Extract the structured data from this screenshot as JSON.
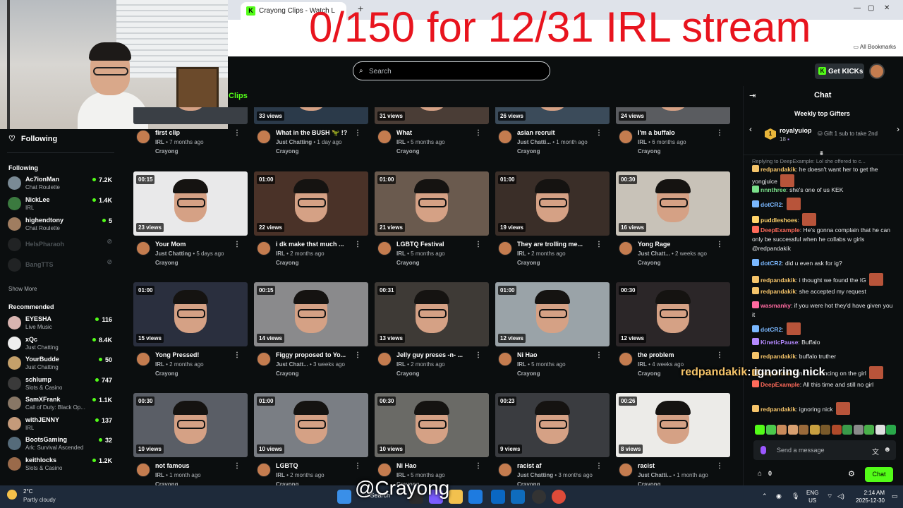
{
  "browser": {
    "tab_title": "Crayong Clips - Watch L",
    "new_tab": "+",
    "bookmarks_label": "All Bookmarks"
  },
  "overlay": {
    "goal_text": "0/150 for 12/31 IRL stream",
    "chat_user": "redpandakik",
    "chat_text": ": ignoring nick",
    "watermark": "@Crayong"
  },
  "topnav": {
    "search_placeholder": "Search",
    "get_kicks": "Get KICKs"
  },
  "sidebar": {
    "following_button": "Following",
    "following_header": "Following",
    "following": [
      {
        "name": "Ac7ionMan",
        "category": "Chat Roulette",
        "viewers": "7.2K",
        "online": true,
        "color": "#7a8a95"
      },
      {
        "name": "NickLee",
        "category": "IRL",
        "viewers": "1.4K",
        "online": true,
        "color": "#3b7a3f"
      },
      {
        "name": "highendtony",
        "category": "Chat Roulette",
        "viewers": "5",
        "online": true,
        "color": "#a07d60"
      },
      {
        "name": "HelsPharaoh",
        "category": "",
        "viewers": "",
        "online": false,
        "color": "#555"
      },
      {
        "name": "BangTTS",
        "category": "",
        "viewers": "",
        "online": false,
        "color": "#555"
      }
    ],
    "show_more": "Show More",
    "recommended_header": "Recommended",
    "recommended": [
      {
        "name": "EYESHA",
        "category": "Live Music",
        "viewers": "116",
        "color": "#d8b4b0"
      },
      {
        "name": "xQc",
        "category": "Just Chatting",
        "viewers": "8.4K",
        "color": "#eeeeee"
      },
      {
        "name": "YourBudde",
        "category": "Just Chatting",
        "viewers": "50",
        "color": "#c4a06a"
      },
      {
        "name": "schlump",
        "category": "Slots & Casino",
        "viewers": "747",
        "color": "#3a3a3a"
      },
      {
        "name": "SamXFrank",
        "category": "Call of Duty: Black Op...",
        "viewers": "1.1K",
        "color": "#887766"
      },
      {
        "name": "withJENNY",
        "category": "IRL",
        "viewers": "137",
        "color": "#c49a7a"
      },
      {
        "name": "BootsGaming",
        "category": "Ark: Survival Ascended",
        "viewers": "32",
        "color": "#556b7a"
      },
      {
        "name": "keithlocks",
        "category": "Slots & Casino",
        "viewers": "1.2K",
        "color": "#9a6a4a"
      }
    ]
  },
  "clips": {
    "section_label": "Clips",
    "items": [
      {
        "title": "first clip",
        "category": "IRL",
        "age": "7 months ago",
        "channel": "Crayong",
        "duration": "",
        "views": "",
        "bg": "#3a3f45"
      },
      {
        "title": "What in the BUSH 🦖 !?",
        "category": "Just Chatting",
        "age": "1 day ago",
        "channel": "Crayong",
        "duration": "",
        "views": "33 views",
        "bg": "#2b3a4a"
      },
      {
        "title": "What",
        "category": "IRL",
        "age": "5 months ago",
        "channel": "Crayong",
        "duration": "",
        "views": "31 views",
        "bg": "#4a3d36"
      },
      {
        "title": "asian recruit",
        "category": "Just Chatti...",
        "age": "1 month ago",
        "channel": "Crayong",
        "duration": "",
        "views": "26 views",
        "bg": "#3b4b5a"
      },
      {
        "title": "I'm a buffalo",
        "category": "IRL",
        "age": "6 months ago",
        "channel": "Crayong",
        "duration": "",
        "views": "24 views",
        "bg": "#5a5c60"
      },
      {
        "title": "Your Mom",
        "category": "Just Chatting",
        "age": "5 days ago",
        "channel": "Crayong",
        "duration": "00:15",
        "views": "23 views",
        "bg": "#e9e9ea"
      },
      {
        "title": "i dk make thst much ...",
        "category": "IRL",
        "age": "2 months ago",
        "channel": "Crayong",
        "duration": "01:00",
        "views": "22 views",
        "bg": "#4a3228"
      },
      {
        "title": "LGBTQ Festival",
        "category": "IRL",
        "age": "5 months ago",
        "channel": "Crayong",
        "duration": "01:00",
        "views": "21 views",
        "bg": "#6a5a4e"
      },
      {
        "title": "They are trolling me...",
        "category": "IRL",
        "age": "2 months ago",
        "channel": "Crayong",
        "duration": "01:00",
        "views": "19 views",
        "bg": "#3a2e28"
      },
      {
        "title": "Yong Rage",
        "category": "Just Chatt...",
        "age": "2 weeks ago",
        "channel": "Crayong",
        "duration": "00:30",
        "views": "16 views",
        "bg": "#c8c2b8"
      },
      {
        "title": "Yong Pressed!",
        "category": "IRL",
        "age": "2 months ago",
        "channel": "Crayong",
        "duration": "01:00",
        "views": "15 views",
        "bg": "#2a2f3e"
      },
      {
        "title": "Figgy proposed to Yo...",
        "category": "Just Chatt...",
        "age": "3 weeks ago",
        "channel": "Crayong",
        "duration": "00:15",
        "views": "14 views",
        "bg": "#8a8a8c"
      },
      {
        "title": "Jelly guy preses -n- ...",
        "category": "IRL",
        "age": "2 months ago",
        "channel": "Crayong",
        "duration": "00:31",
        "views": "13 views",
        "bg": "#3e3a36"
      },
      {
        "title": "Ni Hao",
        "category": "IRL",
        "age": "5 months ago",
        "channel": "Crayong",
        "duration": "01:00",
        "views": "12 views",
        "bg": "#9aa3a8"
      },
      {
        "title": "the problem",
        "category": "IRL",
        "age": "4 weeks ago",
        "channel": "Crayong",
        "duration": "00:30",
        "views": "12 views",
        "bg": "#2b2628"
      },
      {
        "title": "not famous",
        "category": "IRL",
        "age": "1 month ago",
        "channel": "Crayong",
        "duration": "00:30",
        "views": "10 views",
        "bg": "#5a5e66"
      },
      {
        "title": "LGBTQ",
        "category": "IRL",
        "age": "2 months ago",
        "channel": "Crayong",
        "duration": "01:00",
        "views": "10 views",
        "bg": "#7a7e84"
      },
      {
        "title": "Ni Hao",
        "category": "IRL",
        "age": "5 months ago",
        "channel": "Crayong",
        "duration": "00:30",
        "views": "10 views",
        "bg": "#6a6a66"
      },
      {
        "title": "racist af",
        "category": "Just Chatting",
        "age": "3 months ago",
        "channel": "Crayong",
        "duration": "00:23",
        "views": "9 views",
        "bg": "#3a3c40"
      },
      {
        "title": "racist",
        "category": "Just Chatti...",
        "age": "1 month ago",
        "channel": "Crayong",
        "duration": "00:26",
        "views": "8 views",
        "bg": "#ecebe8"
      }
    ]
  },
  "chat": {
    "title": "Chat",
    "gifters_header": "Weekly top Gifters",
    "top_gifter": "royalyuiop",
    "top_gifter_count": "18",
    "gift_prompt": "Gift 1 sub to take 2nd",
    "reply_context": "Replying to DeepExample: Lol she offered to c...",
    "messages": [
      {
        "user": "redpandakik",
        "text": ": he doesn't want her to get the yongjuice",
        "color": "#f5c46a",
        "emote": true
      },
      {
        "user": "nnnthree",
        "text": ": she's one of us KEK",
        "color": "#7ae08a",
        "emote": false
      },
      {
        "user": "dotCR2",
        "text": ":",
        "color": "#7ab8ff",
        "emote": true
      },
      {
        "user": "puddleshoes",
        "text": ":",
        "color": "#ffd36a",
        "emote": true
      },
      {
        "user": "DeepExample",
        "text": ": He's gonna complain that he can only be successful when he collabs w girls @redpandakik",
        "color": "#ff6a5a",
        "emote": false
      },
      {
        "user": "dotCR2",
        "text": ": did u even ask for ig?",
        "color": "#7ab8ff",
        "emote": false
      },
      {
        "user": "redpandakik",
        "text": ": i thought we found the IG",
        "color": "#f5c46a",
        "emote": true
      },
      {
        "user": "redpandakik",
        "text": ": she accepted my request",
        "color": "#f5c46a",
        "emote": false
      },
      {
        "user": "wasmanky",
        "text": ": if you were hot they'd have given you it",
        "color": "#ff6aa0",
        "emote": false
      },
      {
        "user": "dotCR2",
        "text": ":",
        "color": "#7ab8ff",
        "emote": true
      },
      {
        "user": "KineticPause",
        "text": ": Buffalo",
        "color": "#b58aff",
        "emote": false
      },
      {
        "user": "redpandakik",
        "text": ": buffalo truther",
        "color": "#f5c46a",
        "emote": false
      },
      {
        "user": "redpandakik",
        "text": ": nick is cencing on the girl",
        "color": "#f5c46a",
        "emote": true
      },
      {
        "user": "DeepExample",
        "text": ": All this time and still no girl",
        "color": "#ff6a5a",
        "emote": false
      },
      {
        "user": "redpandakik",
        "text": ": ignoring nick",
        "color": "#f5c46a",
        "emote": true
      }
    ],
    "send_placeholder": "Send a message",
    "points": "0",
    "send_button": "Chat"
  },
  "taskbar": {
    "temp": "2°C",
    "condition": "Partly cloudy",
    "search": "Search",
    "lang_top": "ENG",
    "lang_bottom": "US",
    "time": "2:14 AM",
    "date": "2025-12-30"
  }
}
